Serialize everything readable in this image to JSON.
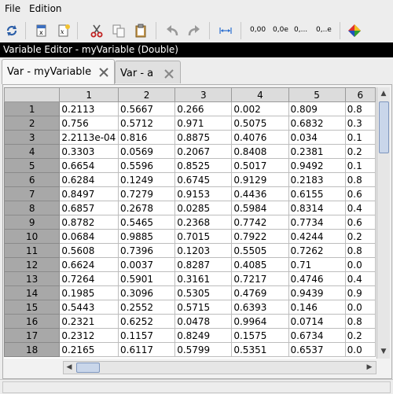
{
  "menubar": {
    "items": [
      "File",
      "Edition"
    ]
  },
  "toolbar": {
    "format_buttons": [
      "0,00",
      "0,0e",
      "0,...",
      "0,..e"
    ]
  },
  "editor_title": "Variable Editor - myVariable  (Double)",
  "tabs": [
    {
      "label": "Var - myVariable",
      "active": true
    },
    {
      "label": "Var - a",
      "active": false
    }
  ],
  "grid": {
    "columns": [
      "1",
      "2",
      "3",
      "4",
      "5",
      "6"
    ],
    "rows": [
      {
        "n": "1",
        "cells": [
          "0.2113",
          "0.5667",
          "0.266",
          "0.002",
          "0.809",
          "0.8"
        ]
      },
      {
        "n": "2",
        "cells": [
          "0.756",
          "0.5712",
          "0.971",
          "0.5075",
          "0.6832",
          "0.3"
        ]
      },
      {
        "n": "3",
        "cells": [
          "2.2113e-04",
          "0.816",
          "0.8875",
          "0.4076",
          "0.034",
          "0.1"
        ]
      },
      {
        "n": "4",
        "cells": [
          "0.3303",
          "0.0569",
          "0.2067",
          "0.8408",
          "0.2381",
          "0.2"
        ]
      },
      {
        "n": "5",
        "cells": [
          "0.6654",
          "0.5596",
          "0.8525",
          "0.5017",
          "0.9492",
          "0.1"
        ]
      },
      {
        "n": "6",
        "cells": [
          "0.6284",
          "0.1249",
          "0.6745",
          "0.9129",
          "0.2183",
          "0.8"
        ]
      },
      {
        "n": "7",
        "cells": [
          "0.8497",
          "0.7279",
          "0.9153",
          "0.4436",
          "0.6155",
          "0.6"
        ]
      },
      {
        "n": "8",
        "cells": [
          "0.6857",
          "0.2678",
          "0.0285",
          "0.5984",
          "0.8314",
          "0.4"
        ]
      },
      {
        "n": "9",
        "cells": [
          "0.8782",
          "0.5465",
          "0.2368",
          "0.7742",
          "0.7734",
          "0.6"
        ]
      },
      {
        "n": "10",
        "cells": [
          "0.0684",
          "0.9885",
          "0.7015",
          "0.7922",
          "0.4244",
          "0.2"
        ]
      },
      {
        "n": "11",
        "cells": [
          "0.5608",
          "0.7396",
          "0.1203",
          "0.5505",
          "0.7262",
          "0.8"
        ]
      },
      {
        "n": "12",
        "cells": [
          "0.6624",
          "0.0037",
          "0.8287",
          "0.4085",
          "0.71",
          "0.0"
        ]
      },
      {
        "n": "13",
        "cells": [
          "0.7264",
          "0.5901",
          "0.3161",
          "0.7217",
          "0.4746",
          "0.4"
        ]
      },
      {
        "n": "14",
        "cells": [
          "0.1985",
          "0.3096",
          "0.5305",
          "0.4769",
          "0.9439",
          "0.9"
        ]
      },
      {
        "n": "15",
        "cells": [
          "0.5443",
          "0.2552",
          "0.5715",
          "0.6393",
          "0.146",
          "0.0"
        ]
      },
      {
        "n": "16",
        "cells": [
          "0.2321",
          "0.6252",
          "0.0478",
          "0.9964",
          "0.0714",
          "0.8"
        ]
      },
      {
        "n": "17",
        "cells": [
          "0.2312",
          "0.1157",
          "0.8249",
          "0.1575",
          "0.6734",
          "0.2"
        ]
      },
      {
        "n": "18",
        "cells": [
          "0.2165",
          "0.6117",
          "0.5799",
          "0.5351",
          "0.6537",
          "0.0"
        ]
      }
    ]
  }
}
